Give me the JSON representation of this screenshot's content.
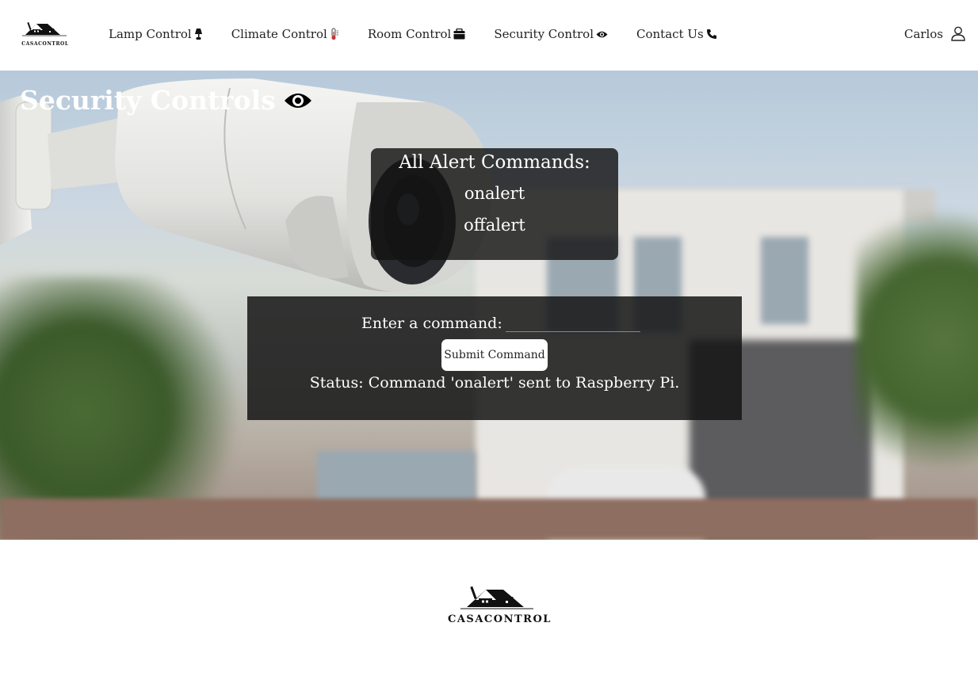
{
  "brand": {
    "name": "CASACONTROL"
  },
  "nav": {
    "links": [
      {
        "label": "Lamp Control",
        "icon": "lamp-icon"
      },
      {
        "label": "Climate Control",
        "icon": "thermometer-icon"
      },
      {
        "label": "Room Control",
        "icon": "room-icon"
      },
      {
        "label": "Security Control",
        "icon": "eye-icon"
      },
      {
        "label": "Contact Us",
        "icon": "phone-icon"
      }
    ],
    "user": {
      "name": "Carlos",
      "icon": "user-icon"
    }
  },
  "hero": {
    "title": "Security Controls",
    "title_icon": "eye-icon"
  },
  "alerts": {
    "title": "All Alert Commands:",
    "items": [
      "onalert",
      "offalert"
    ]
  },
  "command": {
    "label": "Enter a command:",
    "value": "",
    "submit_label": "Submit Command",
    "status": "Status: Command 'onalert' sent to Raspberry Pi."
  },
  "footer": {
    "brand": "CASACONTROL"
  },
  "colors": {
    "panel": "#141414",
    "text_on_panel": "#ffffff",
    "nav_text": "#222222"
  }
}
